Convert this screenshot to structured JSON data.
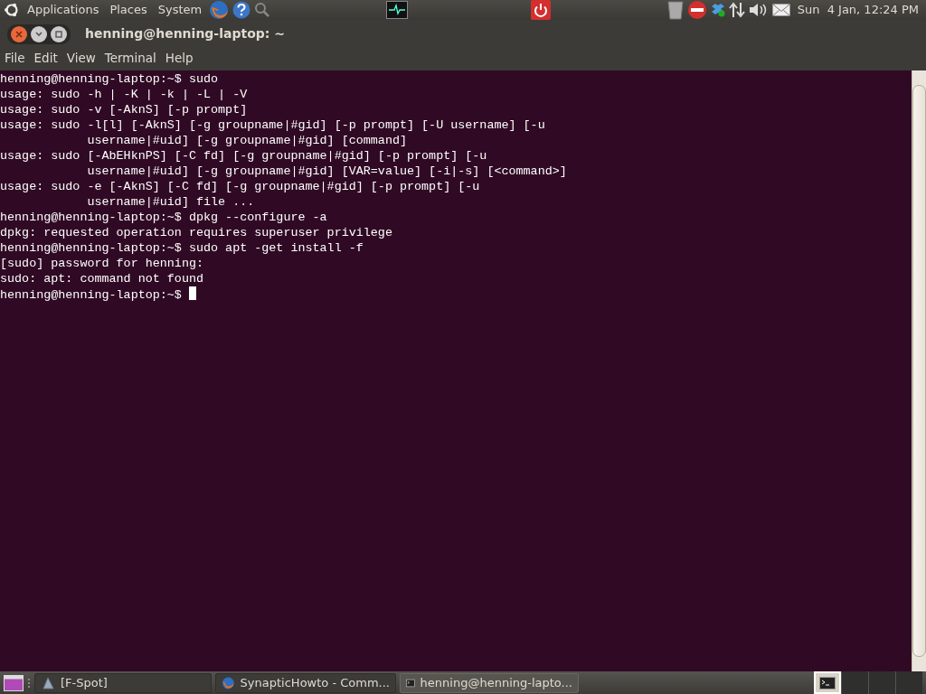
{
  "top_panel": {
    "menus": [
      "Applications",
      "Places",
      "System"
    ],
    "clock": "Sun  4 Jan, 12:24 PM"
  },
  "window": {
    "title": "henning@henning-laptop: ~",
    "menu": [
      "File",
      "Edit",
      "View",
      "Terminal",
      "Help"
    ]
  },
  "terminal": {
    "lines": [
      {
        "kind": "prompt",
        "prompt": "henning@henning-laptop:~$",
        "command": "sudo"
      },
      {
        "kind": "output",
        "text": "usage: sudo -h | -K | -k | -L | -V"
      },
      {
        "kind": "output",
        "text": "usage: sudo -v [-AknS] [-p prompt]"
      },
      {
        "kind": "output",
        "text": "usage: sudo -l[l] [-AknS] [-g groupname|#gid] [-p prompt] [-U username] [-u"
      },
      {
        "kind": "continuation",
        "text": "username|#uid] [-g groupname|#gid] [command]"
      },
      {
        "kind": "output",
        "text": "usage: sudo [-AbEHknPS] [-C fd] [-g groupname|#gid] [-p prompt] [-u"
      },
      {
        "kind": "continuation",
        "text": "username|#uid] [-g groupname|#gid] [VAR=value] [-i|-s] [<command>]"
      },
      {
        "kind": "output",
        "text": "usage: sudo -e [-AknS] [-C fd] [-g groupname|#gid] [-p prompt] [-u"
      },
      {
        "kind": "continuation",
        "text": "username|#uid] file ..."
      },
      {
        "kind": "prompt",
        "prompt": "henning@henning-laptop:~$",
        "command": "dpkg --configure -a"
      },
      {
        "kind": "output",
        "text": "dpkg: requested operation requires superuser privilege"
      },
      {
        "kind": "prompt",
        "prompt": "henning@henning-laptop:~$",
        "command": "sudo apt -get install -f"
      },
      {
        "kind": "output",
        "text": "[sudo] password for henning:"
      },
      {
        "kind": "output",
        "text": "sudo: apt: command not found"
      },
      {
        "kind": "prompt",
        "prompt": "henning@henning-laptop:~$",
        "cursor": true
      }
    ]
  },
  "taskbar": {
    "tasks": [
      {
        "kind": "fspot",
        "label": "[F-Spot]",
        "selected": false
      },
      {
        "kind": "firefox",
        "label": "SynapticHowto - Comm...",
        "selected": false
      },
      {
        "kind": "terminal",
        "label": "henning@henning-lapto...",
        "selected": true
      }
    ],
    "workspaces": [
      {
        "selected": true
      },
      {
        "selected": false
      },
      {
        "selected": false
      },
      {
        "selected": false
      }
    ]
  }
}
